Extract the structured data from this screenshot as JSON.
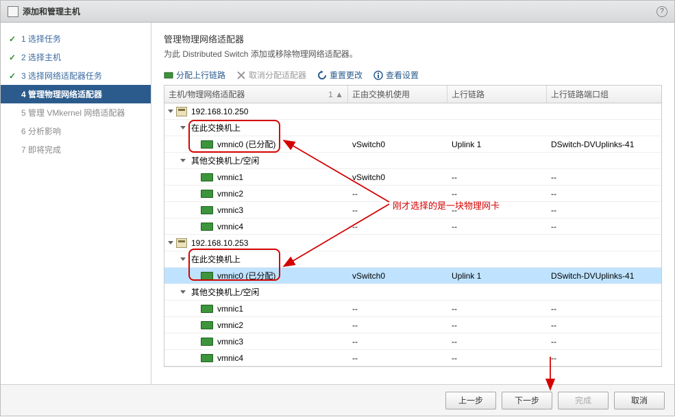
{
  "titlebar": {
    "title": "添加和管理主机"
  },
  "sidebar": {
    "steps": [
      {
        "num": "1",
        "label": "选择任务",
        "done": true
      },
      {
        "num": "2",
        "label": "选择主机",
        "done": true
      },
      {
        "num": "3",
        "label": "选择网络适配器任务",
        "done": true
      },
      {
        "num": "4",
        "label": "管理物理网络适配器",
        "active": true
      },
      {
        "num": "5",
        "label": "管理 VMkernel 网络适配器",
        "future": true
      },
      {
        "num": "6",
        "label": "分析影响",
        "future": true
      },
      {
        "num": "7",
        "label": "即将完成",
        "future": true
      }
    ]
  },
  "page": {
    "title": "管理物理网络适配器",
    "subtitle": "为此 Distributed Switch 添加或移除物理网络适配器。"
  },
  "toolbar": {
    "assign": "分配上行链路",
    "unassign": "取消分配适配器",
    "reset": "重置更改",
    "view": "查看设置"
  },
  "columns": {
    "c1": "主机/物理网络适配器",
    "sort": "1 ▲",
    "c2": "正由交换机使用",
    "c3": "上行链路",
    "c4": "上行链路端口组"
  },
  "tree": [
    {
      "t": "host",
      "ind": 0,
      "label": "192.168.10.250",
      "exp": true
    },
    {
      "t": "grp",
      "ind": 1,
      "label": "在此交换机上",
      "exp": true
    },
    {
      "t": "nic",
      "ind": 2,
      "label": "vmnic0 (已分配)",
      "sw": "vSwitch0",
      "up": "Uplink 1",
      "pg": "DSwitch-DVUplinks-41"
    },
    {
      "t": "grp",
      "ind": 1,
      "label": "其他交换机上/空闲",
      "exp": true
    },
    {
      "t": "nic",
      "ind": 2,
      "label": "vmnic1",
      "sw": "vSwitch0",
      "up": "--",
      "pg": "--"
    },
    {
      "t": "nic",
      "ind": 2,
      "label": "vmnic2",
      "sw": "--",
      "up": "--",
      "pg": "--"
    },
    {
      "t": "nic",
      "ind": 2,
      "label": "vmnic3",
      "sw": "--",
      "up": "--",
      "pg": "--"
    },
    {
      "t": "nic",
      "ind": 2,
      "label": "vmnic4",
      "sw": "--",
      "up": "--",
      "pg": "--"
    },
    {
      "t": "host",
      "ind": 0,
      "label": "192.168.10.253",
      "exp": true
    },
    {
      "t": "grp",
      "ind": 1,
      "label": "在此交换机上",
      "exp": true
    },
    {
      "t": "nic",
      "ind": 2,
      "label": "vmnic0 (已分配)",
      "sw": "vSwitch0",
      "up": "Uplink 1",
      "pg": "DSwitch-DVUplinks-41",
      "sel": true
    },
    {
      "t": "grp",
      "ind": 1,
      "label": "其他交换机上/空闲",
      "exp": true
    },
    {
      "t": "nic",
      "ind": 2,
      "label": "vmnic1",
      "sw": "--",
      "up": "--",
      "pg": "--"
    },
    {
      "t": "nic",
      "ind": 2,
      "label": "vmnic2",
      "sw": "--",
      "up": "--",
      "pg": "--"
    },
    {
      "t": "nic",
      "ind": 2,
      "label": "vmnic3",
      "sw": "--",
      "up": "--",
      "pg": "--"
    },
    {
      "t": "nic",
      "ind": 2,
      "label": "vmnic4",
      "sw": "--",
      "up": "--",
      "pg": "--"
    }
  ],
  "footer": {
    "back": "上一步",
    "next": "下一步",
    "finish": "完成",
    "cancel": "取消"
  },
  "annotation": {
    "text": "刚才选择的是一块物理网卡"
  }
}
